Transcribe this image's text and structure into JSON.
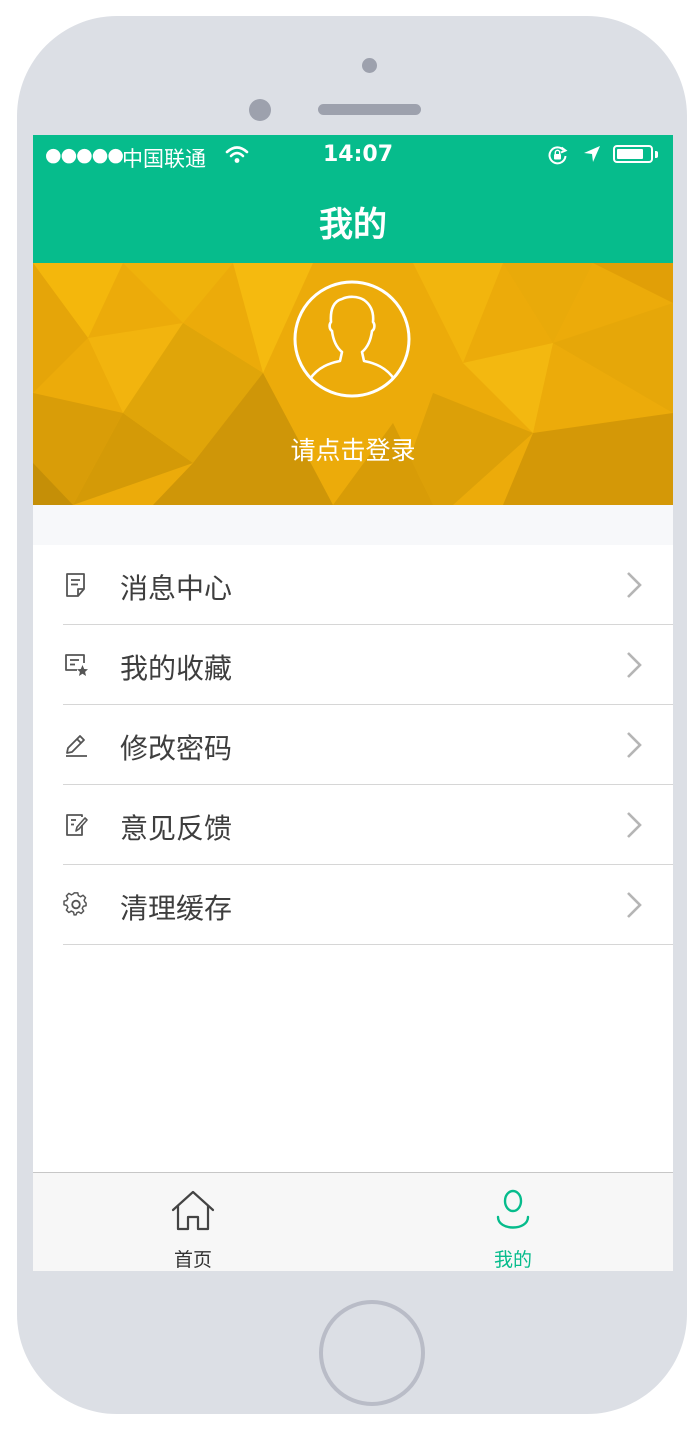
{
  "status_bar": {
    "signal": "●●●●●",
    "carrier": "中国联通",
    "time": "14:07"
  },
  "nav": {
    "title": "我的"
  },
  "profile": {
    "login_prompt": "请点击登录"
  },
  "menu": {
    "items": [
      {
        "label": "消息中心",
        "icon": "message-doc-icon"
      },
      {
        "label": "我的收藏",
        "icon": "favorites-star-icon"
      },
      {
        "label": "修改密码",
        "icon": "pencil-icon"
      },
      {
        "label": "意见反馈",
        "icon": "feedback-edit-icon"
      },
      {
        "label": "清理缓存",
        "icon": "gear-icon"
      }
    ]
  },
  "tabbar": {
    "tabs": [
      {
        "label": "首页",
        "icon": "home-icon",
        "active": false
      },
      {
        "label": "我的",
        "icon": "person-icon",
        "active": true
      }
    ]
  },
  "colors": {
    "primary": "#06bc8c",
    "banner": "#ecad0a",
    "active_tab": "#06bc8c",
    "inactive_tab": "#333333"
  }
}
